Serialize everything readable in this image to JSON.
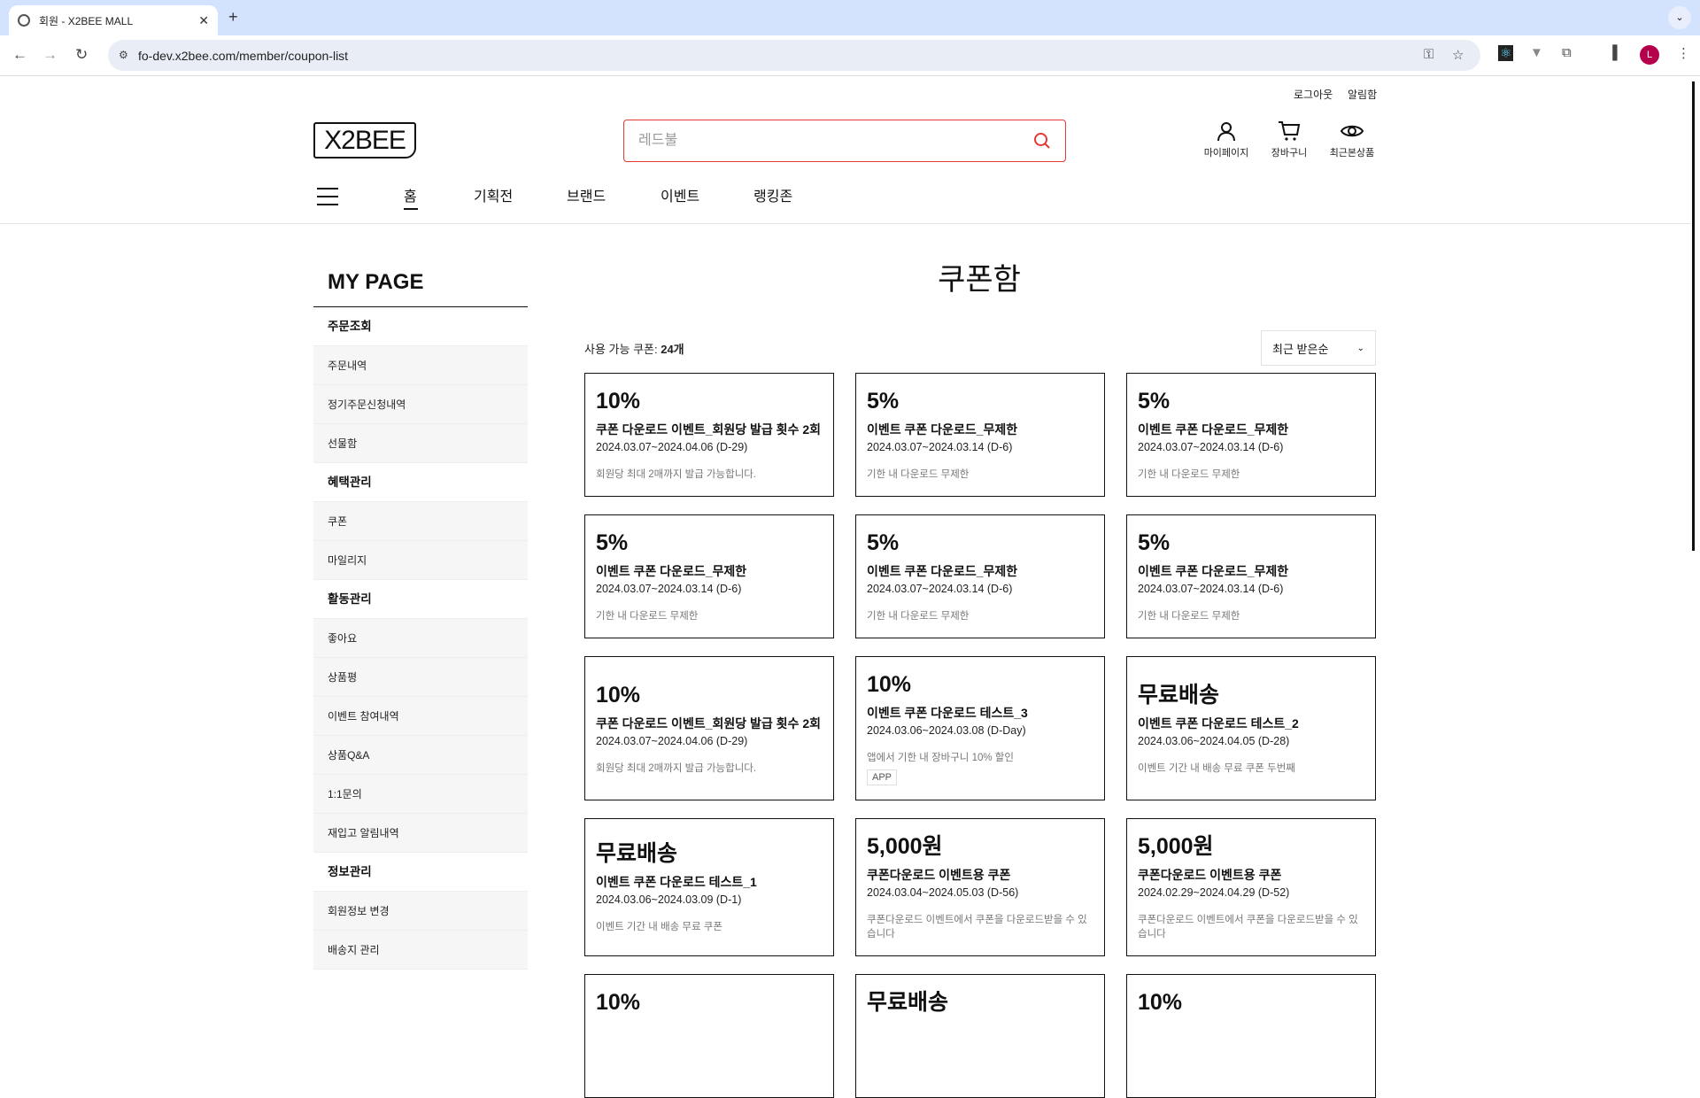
{
  "browser": {
    "tab_title": "회원 - X2BEE MALL",
    "url": "fo-dev.x2bee.com/member/coupon-list",
    "profile_initial": "L"
  },
  "header": {
    "top_links": [
      "로그아웃",
      "알림함"
    ],
    "logo": "X2BEE",
    "search_placeholder": "레드불",
    "icons": [
      {
        "label": "마이페이지",
        "icon": "user-icon"
      },
      {
        "label": "장바구니",
        "icon": "cart-icon"
      },
      {
        "label": "최근본상품",
        "icon": "eye-icon"
      }
    ],
    "nav": [
      "홈",
      "기획전",
      "브랜드",
      "이벤트",
      "랭킹존"
    ]
  },
  "sidebar": {
    "title": "MY PAGE",
    "groups": [
      {
        "label": "주문조회",
        "items": [
          "주문내역",
          "정기주문신청내역",
          "선물함"
        ]
      },
      {
        "label": "혜택관리",
        "items": [
          "쿠폰",
          "마일리지"
        ]
      },
      {
        "label": "활동관리",
        "items": [
          "좋아요",
          "상품평",
          "이벤트 참여내역",
          "상품Q&A",
          "1:1문의",
          "재입고 알림내역"
        ]
      },
      {
        "label": "정보관리",
        "items": [
          "회원정보 변경",
          "배송지 관리"
        ]
      }
    ]
  },
  "main": {
    "title": "쿠폰함",
    "count_label": "사용 가능 쿠폰: ",
    "count_value": "24개",
    "sort": "최근 받은순",
    "coupons": [
      {
        "amount": "10%",
        "name": "쿠폰 다운로드 이벤트_회원당 발급 횟수 2회",
        "period": "2024.03.07~2024.04.06 (D-29)",
        "desc": "회원당 최대 2매까지 발급 가능합니다."
      },
      {
        "amount": "5%",
        "name": "이벤트 쿠폰 다운로드_무제한",
        "period": "2024.03.07~2024.03.14 (D-6)",
        "desc": "기한 내 다운로드 무제한"
      },
      {
        "amount": "5%",
        "name": "이벤트 쿠폰 다운로드_무제한",
        "period": "2024.03.07~2024.03.14 (D-6)",
        "desc": "기한 내 다운로드 무제한"
      },
      {
        "amount": "5%",
        "name": "이벤트 쿠폰 다운로드_무제한",
        "period": "2024.03.07~2024.03.14 (D-6)",
        "desc": "기한 내 다운로드 무제한"
      },
      {
        "amount": "5%",
        "name": "이벤트 쿠폰 다운로드_무제한",
        "period": "2024.03.07~2024.03.14 (D-6)",
        "desc": "기한 내 다운로드 무제한"
      },
      {
        "amount": "5%",
        "name": "이벤트 쿠폰 다운로드_무제한",
        "period": "2024.03.07~2024.03.14 (D-6)",
        "desc": "기한 내 다운로드 무제한"
      },
      {
        "amount": "10%",
        "name": "쿠폰 다운로드 이벤트_회원당 발급 횟수 2회",
        "period": "2024.03.07~2024.04.06 (D-29)",
        "desc": "회원당 최대 2매까지 발급 가능합니다."
      },
      {
        "amount": "10%",
        "name": "이벤트 쿠폰 다운로드 테스트_3",
        "period": "2024.03.06~2024.03.08 (D-Day)",
        "desc": "앱에서 기한 내 장바구니 10% 할인",
        "badge": "APP"
      },
      {
        "amount": "무료배송",
        "name": "이벤트 쿠폰 다운로드 테스트_2",
        "period": "2024.03.06~2024.04.05 (D-28)",
        "desc": "이벤트 기간 내 배송 무료 쿠폰 두번째"
      },
      {
        "amount": "무료배송",
        "name": "이벤트 쿠폰 다운로드 테스트_1",
        "period": "2024.03.06~2024.03.09 (D-1)",
        "desc": "이벤트 기간 내 배송 무료 쿠폰"
      },
      {
        "amount": "5,000원",
        "name": "쿠폰다운로드 이벤트용 쿠폰",
        "period": "2024.03.04~2024.05.03 (D-56)",
        "desc": "쿠폰다운로드 이벤트에서 쿠폰을 다운로드받을 수 있습니다"
      },
      {
        "amount": "5,000원",
        "name": "쿠폰다운로드 이벤트용 쿠폰",
        "period": "2024.02.29~2024.04.29 (D-52)",
        "desc": "쿠폰다운로드 이벤트에서 쿠폰을 다운로드받을 수 있습니다"
      },
      {
        "amount": "10%"
      },
      {
        "amount": "무료배송"
      },
      {
        "amount": "10%"
      }
    ]
  }
}
